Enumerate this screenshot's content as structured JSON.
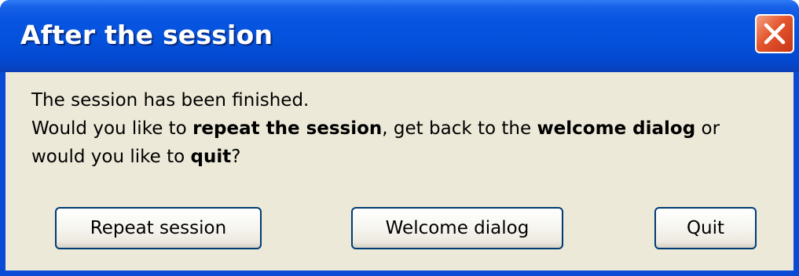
{
  "window": {
    "title": "After the session"
  },
  "titlebar": {
    "close_icon": "close-icon"
  },
  "message": {
    "line1": "The session has been finished.",
    "line2_prefix": "Would you like to ",
    "line2_repeat": "repeat the session",
    "line2_mid": ", get back to the ",
    "line2_welcome": "welcome dialog",
    "line2_or": " or",
    "line3_prefix": "would you like to ",
    "line3_quit": "quit",
    "line3_suffix": "?"
  },
  "buttons": {
    "repeat_label": "Repeat session",
    "welcome_label": "Welcome dialog",
    "quit_label": "Quit"
  },
  "colors": {
    "titlebar": "#0452dc",
    "client": "#ece9d8",
    "close_button": "#e3552c",
    "button_border": "#003c74"
  }
}
